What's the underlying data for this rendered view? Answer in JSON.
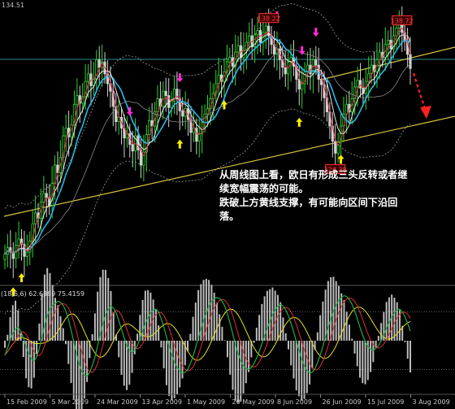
{
  "chart_data": [
    {
      "type": "candlestick",
      "top_label": "134.51",
      "price_ylim": [
        113.5,
        138.5
      ],
      "date_ticks": [
        "15 Feb 2009",
        "5 Mar 2009",
        "24 Mar 2009",
        "13 Apr 2009",
        "1 May 2009",
        "20 May 2009",
        "8 Jun 2009",
        "26 Jun 2009",
        "15 Jul 2009",
        "3 Aug 2009"
      ],
      "price_labels": [
        {
          "text": "138.22",
          "bar": 95,
          "price": 137.7
        },
        {
          "text": "138.72",
          "bar": 143,
          "price": 137.5
        },
        {
          "text": "124.38",
          "bar": 119,
          "price": 123.8
        }
      ],
      "close": [
        116.0,
        116.6,
        116.2,
        115.6,
        116.8,
        117.4,
        116.9,
        115.8,
        116.2,
        117.2,
        118.8,
        119.8,
        119.3,
        120.8,
        121.6,
        121.2,
        120.5,
        122.5,
        124.2,
        123.5,
        124.9,
        126.9,
        127.6,
        126.8,
        127.9,
        129.8,
        130.6,
        129.9,
        130.5,
        131.9,
        132.6,
        131.5,
        132.1,
        133.9,
        133.2,
        133.7,
        132.6,
        131.7,
        131.0,
        129.6,
        128.2,
        128.6,
        127.6,
        126.7,
        127.1,
        126.1,
        125.5,
        126.9,
        125.6,
        124.2,
        125.4,
        127.0,
        128.3,
        127.8,
        129.1,
        130.3,
        129.6,
        131.0,
        130.6,
        129.5,
        130.1,
        131.2,
        130.3,
        129.2,
        128.7,
        129.4,
        128.4,
        127.2,
        127.6,
        126.4,
        127.1,
        128.1,
        128.9,
        129.4,
        130.3,
        130.8,
        131.7,
        132.5,
        131.9,
        132.8,
        133.7,
        134.1,
        133.3,
        134.6,
        135.2,
        134.1,
        134.8,
        135.5,
        136.1,
        135.1,
        136.2,
        136.6,
        135.5,
        136.4,
        137.0,
        136.1,
        135.3,
        134.4,
        134.9,
        133.9,
        133.2,
        132.6,
        133.7,
        134.1,
        133.3,
        132.1,
        131.2,
        131.7,
        132.8,
        133.4,
        132.6,
        133.9,
        133.4,
        132.1,
        131.6,
        130.4,
        129.1,
        127.8,
        126.4,
        125.3,
        126.3,
        127.8,
        128.9,
        129.8,
        129.1,
        130.3,
        131.4,
        132.0,
        131.3,
        130.8,
        131.9,
        132.6,
        133.4,
        132.8,
        133.9,
        134.6,
        134.1,
        135.3,
        135.7,
        134.9,
        136.1,
        136.8,
        137.2,
        136.4,
        135.6,
        134.4,
        133.1
      ],
      "open": 115.5,
      "fib_ma": [
        {
          "name": "ma-cyan",
          "color": "#28b8e8",
          "period": 10,
          "width": 1.6
        },
        {
          "name": "ma-white",
          "color": "#e8e8e8",
          "period": 6,
          "width": 1.0
        },
        {
          "name": "ma-red",
          "color": "#e0304a",
          "period": 3,
          "width": 1.0
        },
        {
          "name": "ma-gray",
          "color": "#8a8a8a",
          "period": 24,
          "width": 0.8
        }
      ],
      "up_arrow_bars": [
        3,
        6,
        63,
        79,
        106,
        121
      ],
      "down_arrow_bars": [
        45,
        63,
        98,
        107,
        112
      ],
      "annotation": [
        "从周线图上看，欧日有形成三头反转或者继",
        "续宽幅震荡的可能。",
        "跌破上方黄线支撑，有可能向区间下沿回",
        "落。"
      ],
      "colors": {
        "candle_up": "#32d232",
        "candle_down": "#d0d0d0",
        "trendline": "#d8c040",
        "horizontal_line": "#2e8c8c",
        "bands": "#9a9a9a",
        "arrow_forecast": "#ff2020"
      }
    },
    {
      "type": "oscillator",
      "title": "(18,6,6) 62.6889 75.4159",
      "ylim": [
        0,
        100
      ],
      "main_color": "#22aa44",
      "signal_color": "#e03030",
      "third_color": "#e8e020",
      "histogram_color": "#bcbcbc",
      "levels": [
        80,
        20
      ],
      "main": [
        35,
        42,
        51,
        58,
        62,
        64,
        60,
        53,
        44,
        37,
        31,
        29,
        33,
        42,
        54,
        66,
        76,
        83,
        87,
        89,
        91,
        90,
        87,
        81,
        72,
        61,
        49,
        37,
        26,
        18,
        14,
        13,
        17,
        24,
        33,
        45,
        57,
        68,
        77,
        83,
        86,
        84,
        79,
        71,
        62,
        53,
        45,
        40,
        38,
        40,
        45,
        52,
        60,
        68,
        74,
        79,
        82,
        83,
        80,
        73,
        64,
        54,
        44,
        35,
        28,
        22,
        18,
        16,
        17,
        20,
        26,
        34,
        43,
        53,
        62,
        71,
        79,
        86,
        91,
        94,
        95,
        94,
        91,
        86,
        78,
        68,
        57,
        46,
        37,
        29,
        24,
        21,
        20,
        22,
        26,
        32,
        39,
        47,
        55,
        63,
        70,
        77,
        82,
        86,
        88,
        86,
        82,
        76,
        68,
        59,
        49,
        40,
        31,
        24,
        19,
        16,
        17,
        21,
        27,
        35,
        44,
        54,
        64,
        73,
        81,
        87,
        92,
        95,
        97,
        96,
        93,
        88,
        81,
        73,
        64,
        56,
        49,
        44,
        41,
        40,
        42,
        45,
        50,
        56,
        63,
        69,
        75,
        79,
        82,
        83,
        80,
        75,
        68,
        60
      ]
    }
  ],
  "date_axis": [
    "15 Feb 2009",
    "5 Mar 2009",
    "24 Mar 2009",
    "13 Apr 2009",
    "1 May 2009",
    "20 May 2009",
    "8 Jun 2009",
    "26 Jun 2009",
    "15 Jul 2009",
    "3 Aug 2009"
  ]
}
